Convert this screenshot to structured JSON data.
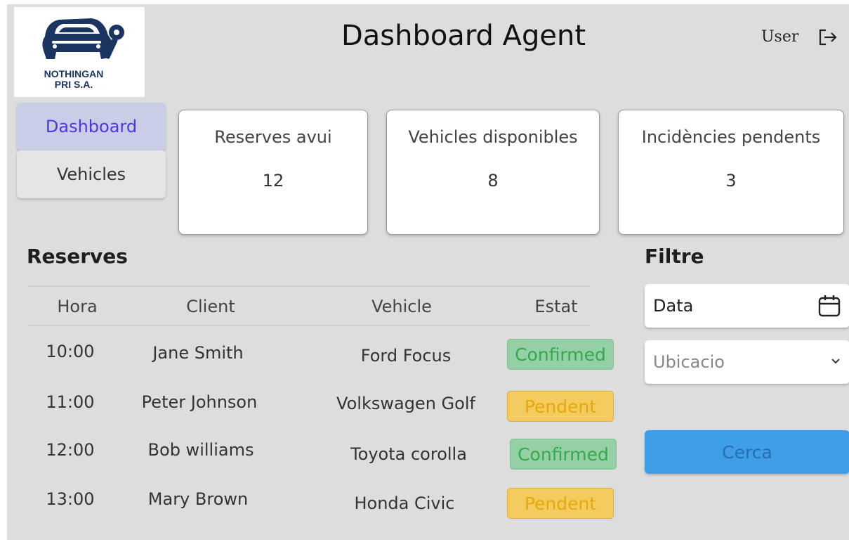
{
  "brand": {
    "name_line1": "NOTHINGAN",
    "name_line2": "PRI S.A."
  },
  "header": {
    "title": "Dashboard Agent",
    "user_label": "User"
  },
  "sidebar": {
    "items": [
      {
        "label": "Dashboard",
        "active": true
      },
      {
        "label": "Vehicles",
        "active": false
      }
    ]
  },
  "stats": [
    {
      "label": "Reserves avui",
      "value": "12"
    },
    {
      "label": "Vehicles disponibles",
      "value": "8"
    },
    {
      "label": "Incidències pendents",
      "value": "3"
    }
  ],
  "reserves": {
    "title": "Reserves",
    "columns": [
      "Hora",
      "Client",
      "Vehicle",
      "Estat"
    ],
    "rows": [
      {
        "hora": "10:00",
        "client": "Jane Smith",
        "vehicle": "Ford Focus",
        "estat": "Confirmed"
      },
      {
        "hora": "11:00",
        "client": "Peter Johnson",
        "vehicle": "Volkswagen Golf",
        "estat": "Pendent"
      },
      {
        "hora": "12:00",
        "client": "Bob williams",
        "vehicle": "Toyota corolla",
        "estat": "Confirmed"
      },
      {
        "hora": "13:00",
        "client": "Mary Brown",
        "vehicle": "Honda Civic",
        "estat": "Pendent"
      }
    ]
  },
  "filter": {
    "title": "Filtre",
    "date_value": "Data",
    "location_placeholder": "Ubicacio",
    "search_label": "Cerca"
  },
  "colors": {
    "accent": "#4a37e8",
    "confirmed_bg": "#95cfa6",
    "pending_bg": "#f4cb5f",
    "button_bg": "#3e9ee8",
    "brand_navy": "#1a3560"
  },
  "icons": {
    "logo": "car-key-logo-icon",
    "logout": "logout-icon",
    "calendar": "calendar-icon",
    "dropdown": "chevron-down-icon"
  }
}
